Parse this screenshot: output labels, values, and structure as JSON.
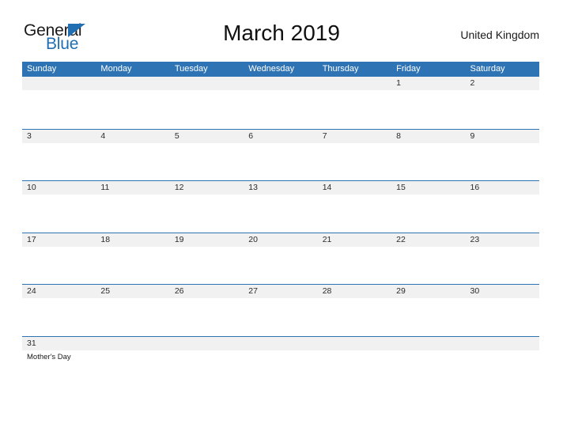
{
  "brand": {
    "word_one": "General",
    "word_two": "Blue",
    "triangle_icon": "triangle-icon",
    "accent_color": "#1f6fb2"
  },
  "header": {
    "title": "March 2019",
    "country": "United Kingdom"
  },
  "theme": {
    "header_blue": "#2e74b5",
    "row_band_gray": "#f1f1f1",
    "separator_blue": "#2e74b5",
    "text_dark": "#2b2b2b"
  },
  "calendar": {
    "weekdays": [
      "Sunday",
      "Monday",
      "Tuesday",
      "Wednesday",
      "Thursday",
      "Friday",
      "Saturday"
    ],
    "weeks": [
      {
        "days": [
          {
            "num": "",
            "event": ""
          },
          {
            "num": "",
            "event": ""
          },
          {
            "num": "",
            "event": ""
          },
          {
            "num": "",
            "event": ""
          },
          {
            "num": "",
            "event": ""
          },
          {
            "num": "1",
            "event": ""
          },
          {
            "num": "2",
            "event": ""
          }
        ]
      },
      {
        "days": [
          {
            "num": "3",
            "event": ""
          },
          {
            "num": "4",
            "event": ""
          },
          {
            "num": "5",
            "event": ""
          },
          {
            "num": "6",
            "event": ""
          },
          {
            "num": "7",
            "event": ""
          },
          {
            "num": "8",
            "event": ""
          },
          {
            "num": "9",
            "event": ""
          }
        ]
      },
      {
        "days": [
          {
            "num": "10",
            "event": ""
          },
          {
            "num": "11",
            "event": ""
          },
          {
            "num": "12",
            "event": ""
          },
          {
            "num": "13",
            "event": ""
          },
          {
            "num": "14",
            "event": ""
          },
          {
            "num": "15",
            "event": ""
          },
          {
            "num": "16",
            "event": ""
          }
        ]
      },
      {
        "days": [
          {
            "num": "17",
            "event": ""
          },
          {
            "num": "18",
            "event": ""
          },
          {
            "num": "19",
            "event": ""
          },
          {
            "num": "20",
            "event": ""
          },
          {
            "num": "21",
            "event": ""
          },
          {
            "num": "22",
            "event": ""
          },
          {
            "num": "23",
            "event": ""
          }
        ]
      },
      {
        "days": [
          {
            "num": "24",
            "event": ""
          },
          {
            "num": "25",
            "event": ""
          },
          {
            "num": "26",
            "event": ""
          },
          {
            "num": "27",
            "event": ""
          },
          {
            "num": "28",
            "event": ""
          },
          {
            "num": "29",
            "event": ""
          },
          {
            "num": "30",
            "event": ""
          }
        ]
      },
      {
        "days": [
          {
            "num": "31",
            "event": "Mother's Day"
          },
          {
            "num": "",
            "event": ""
          },
          {
            "num": "",
            "event": ""
          },
          {
            "num": "",
            "event": ""
          },
          {
            "num": "",
            "event": ""
          },
          {
            "num": "",
            "event": ""
          },
          {
            "num": "",
            "event": ""
          }
        ]
      }
    ]
  }
}
